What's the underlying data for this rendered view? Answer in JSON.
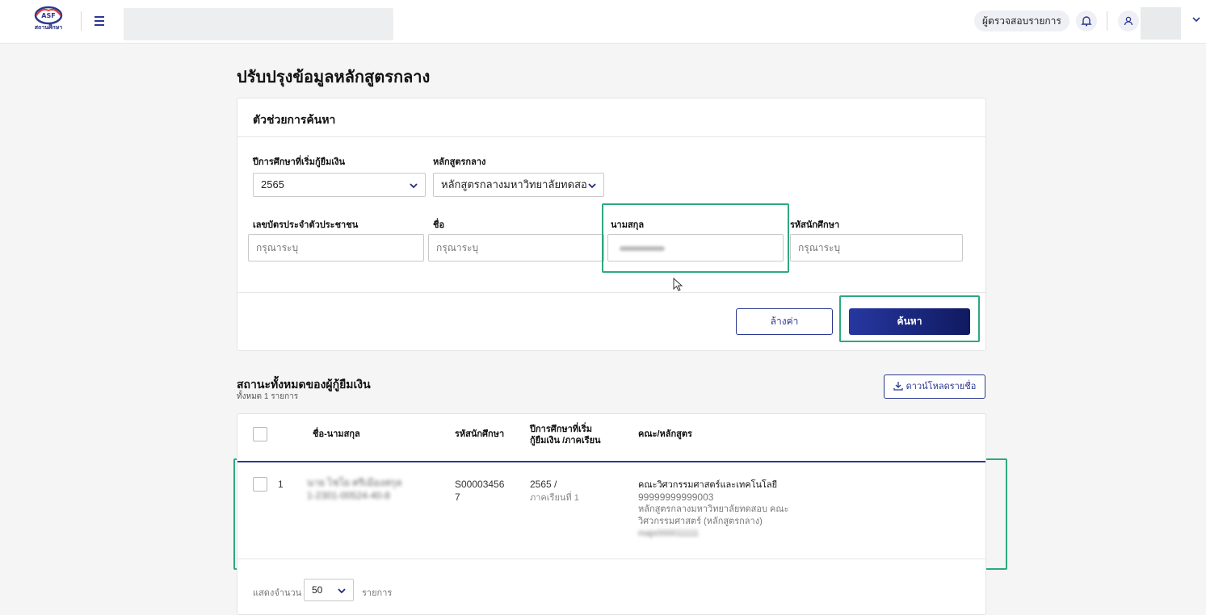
{
  "header": {
    "logo_text": "สถานศึกษา",
    "role": "ผู้ตรวจสอบรายการ"
  },
  "page": {
    "title": "ปรับปรุงข้อมูลหลักสูตรกลาง"
  },
  "search_panel": {
    "title": "ตัวช่วยการค้นหา",
    "fields": {
      "academic_year": {
        "label": "ปีการศึกษาที่เริ่มกู้ยืมเงิน",
        "value": "2565"
      },
      "central_course": {
        "label": "หลักสูตรกลาง",
        "value": "หลักสูตรกลางมหาวิทยาลัยทดสอบ"
      },
      "national_id": {
        "label": "เลขบัตรประจำตัวประชาชน",
        "placeholder": "กรุณาระบุ"
      },
      "first_name": {
        "label": "ชื่อ",
        "placeholder": "กรุณาระบุ"
      },
      "last_name": {
        "label": "นามสกุล",
        "value": ""
      },
      "student_id": {
        "label": "รหัสนักศึกษา",
        "placeholder": "กรุณาระบุ"
      }
    },
    "clear_label": "ล้างค่า",
    "search_label": "ค้นหา"
  },
  "results": {
    "title": "สถานะทั้งหมดของผู้กู้ยืมเงิน",
    "count_text": "ทั้งหมด 1 รายการ",
    "download_label": "ดาวน์โหลดรายชื่อ",
    "columns": [
      "ชื่อ-นามสกุล",
      "รหัสนักศึกษา",
      "ปีการศึกษาที่เริ่ม",
      "กู้ยืมเงิน /ภาคเรียน",
      "คณะ/หลักสูตร"
    ],
    "rows": [
      {
        "index": "1",
        "name": "นาย ไชโย ศรีเมืองสกุล",
        "national_id": "1-2301-00524-40-8",
        "student_id_line1": "S00003456",
        "student_id_line2": "7",
        "year": "2565 /",
        "term": "ภาคเรียนที่ 1",
        "faculty": "คณะวิศวกรรมศาสตร์และเทคโนโลยี",
        "faculty_code": "99999999999003",
        "course_line1": "หลักสูตรกลางมหาวิทยาลัยทดสอบ คณะ",
        "course_line2": "วิศวกรรมศาสตร์ (หลักสูตรกลาง)",
        "course_code": "majx000011111"
      }
    ]
  },
  "pagination": {
    "show_label": "แสดงจำนวน",
    "page_size": "50",
    "unit_label": "รายการ"
  }
}
